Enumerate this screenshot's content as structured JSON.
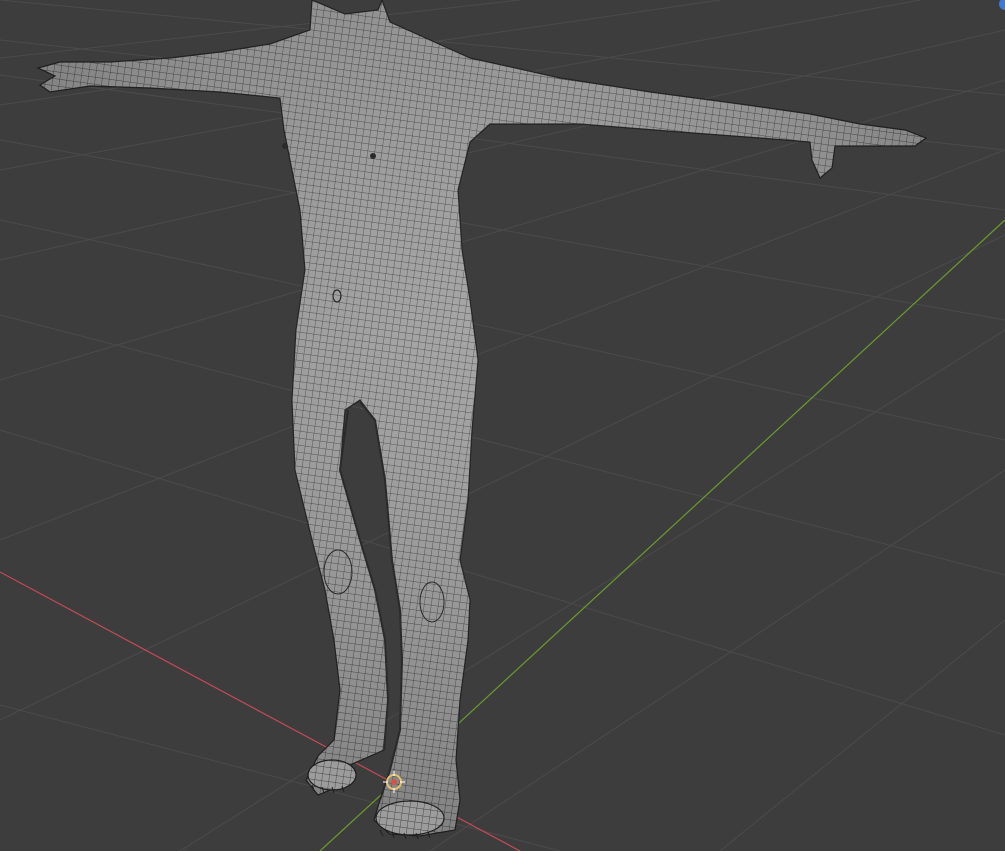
{
  "viewport": {
    "view": "3D viewport",
    "shading": "solid",
    "overlay": "wireframe",
    "background_color": "#3d3d3d",
    "grid_line_color": "#4b4b4b",
    "x_axis_color": "#c24a58",
    "y_axis_color": "#6c9a2f",
    "mesh_color": "#9c9c9c",
    "wire_color": "#2a2a2a",
    "origin_marker_color": "#e7c06a",
    "gizmo_accent_color": "#3d7ad8"
  },
  "scene": {
    "object": "character-mesh",
    "pose": "t-pose",
    "origin_marker": "3d-cursor"
  },
  "icons": {
    "cursor": "3d-cursor-icon",
    "gizmo": "navigation-gizmo-icon"
  }
}
